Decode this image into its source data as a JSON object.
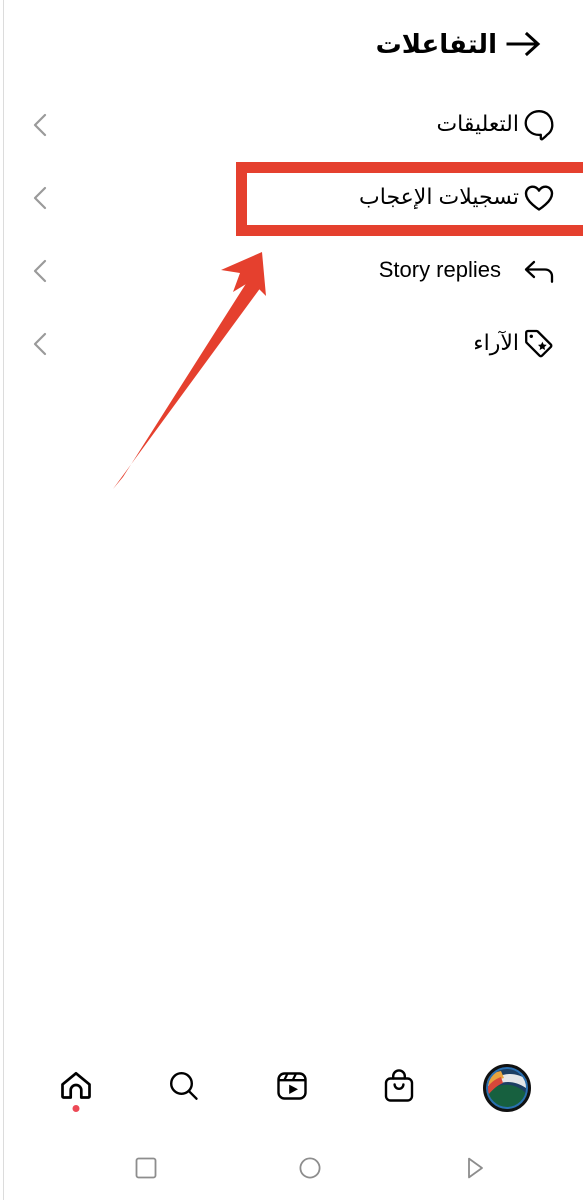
{
  "header": {
    "title": "التفاعلات",
    "back_icon": "arrow-right-icon"
  },
  "list": {
    "items": [
      {
        "label": "التعليقات",
        "icon": "comment-bubble-icon",
        "chevron": "chevron-left-icon",
        "dir": "rtl",
        "highlighted": false
      },
      {
        "label": "تسجيلات الإعجاب",
        "icon": "heart-icon",
        "chevron": "chevron-left-icon",
        "dir": "rtl",
        "highlighted": true
      },
      {
        "label": "Story replies",
        "icon": "reply-arrow-icon",
        "chevron": "chevron-left-icon",
        "dir": "ltr",
        "highlighted": false
      },
      {
        "label": "الآراء",
        "icon": "tag-star-icon",
        "chevron": "chevron-left-icon",
        "dir": "rtl",
        "highlighted": false
      }
    ]
  },
  "bottom_nav": {
    "items": [
      {
        "icon": "profile-avatar",
        "name": "profile"
      },
      {
        "icon": "shopping-bag-icon",
        "name": "shop"
      },
      {
        "icon": "reels-icon",
        "name": "reels"
      },
      {
        "icon": "search-icon",
        "name": "search"
      },
      {
        "icon": "home-icon",
        "name": "home",
        "badge": true
      }
    ]
  },
  "system_nav": {
    "items": [
      {
        "icon": "square-icon",
        "name": "recents"
      },
      {
        "icon": "circle-icon",
        "name": "home"
      },
      {
        "icon": "triangle-right-icon",
        "name": "back"
      }
    ]
  },
  "annotations": {
    "highlight_color": "#E5402E",
    "arrow_color": "#E5402E",
    "highlight_target": "تسجيلات الإعجاب",
    "arrow_from": "115,485",
    "arrow_to": "262,255"
  },
  "colors": {
    "accent_red": "#E5402E",
    "badge_red": "#ED4956",
    "chevron_grey": "#9a9a9a",
    "system_nav_grey": "#8d8d8d",
    "text_black": "#000000",
    "background": "#ffffff"
  }
}
